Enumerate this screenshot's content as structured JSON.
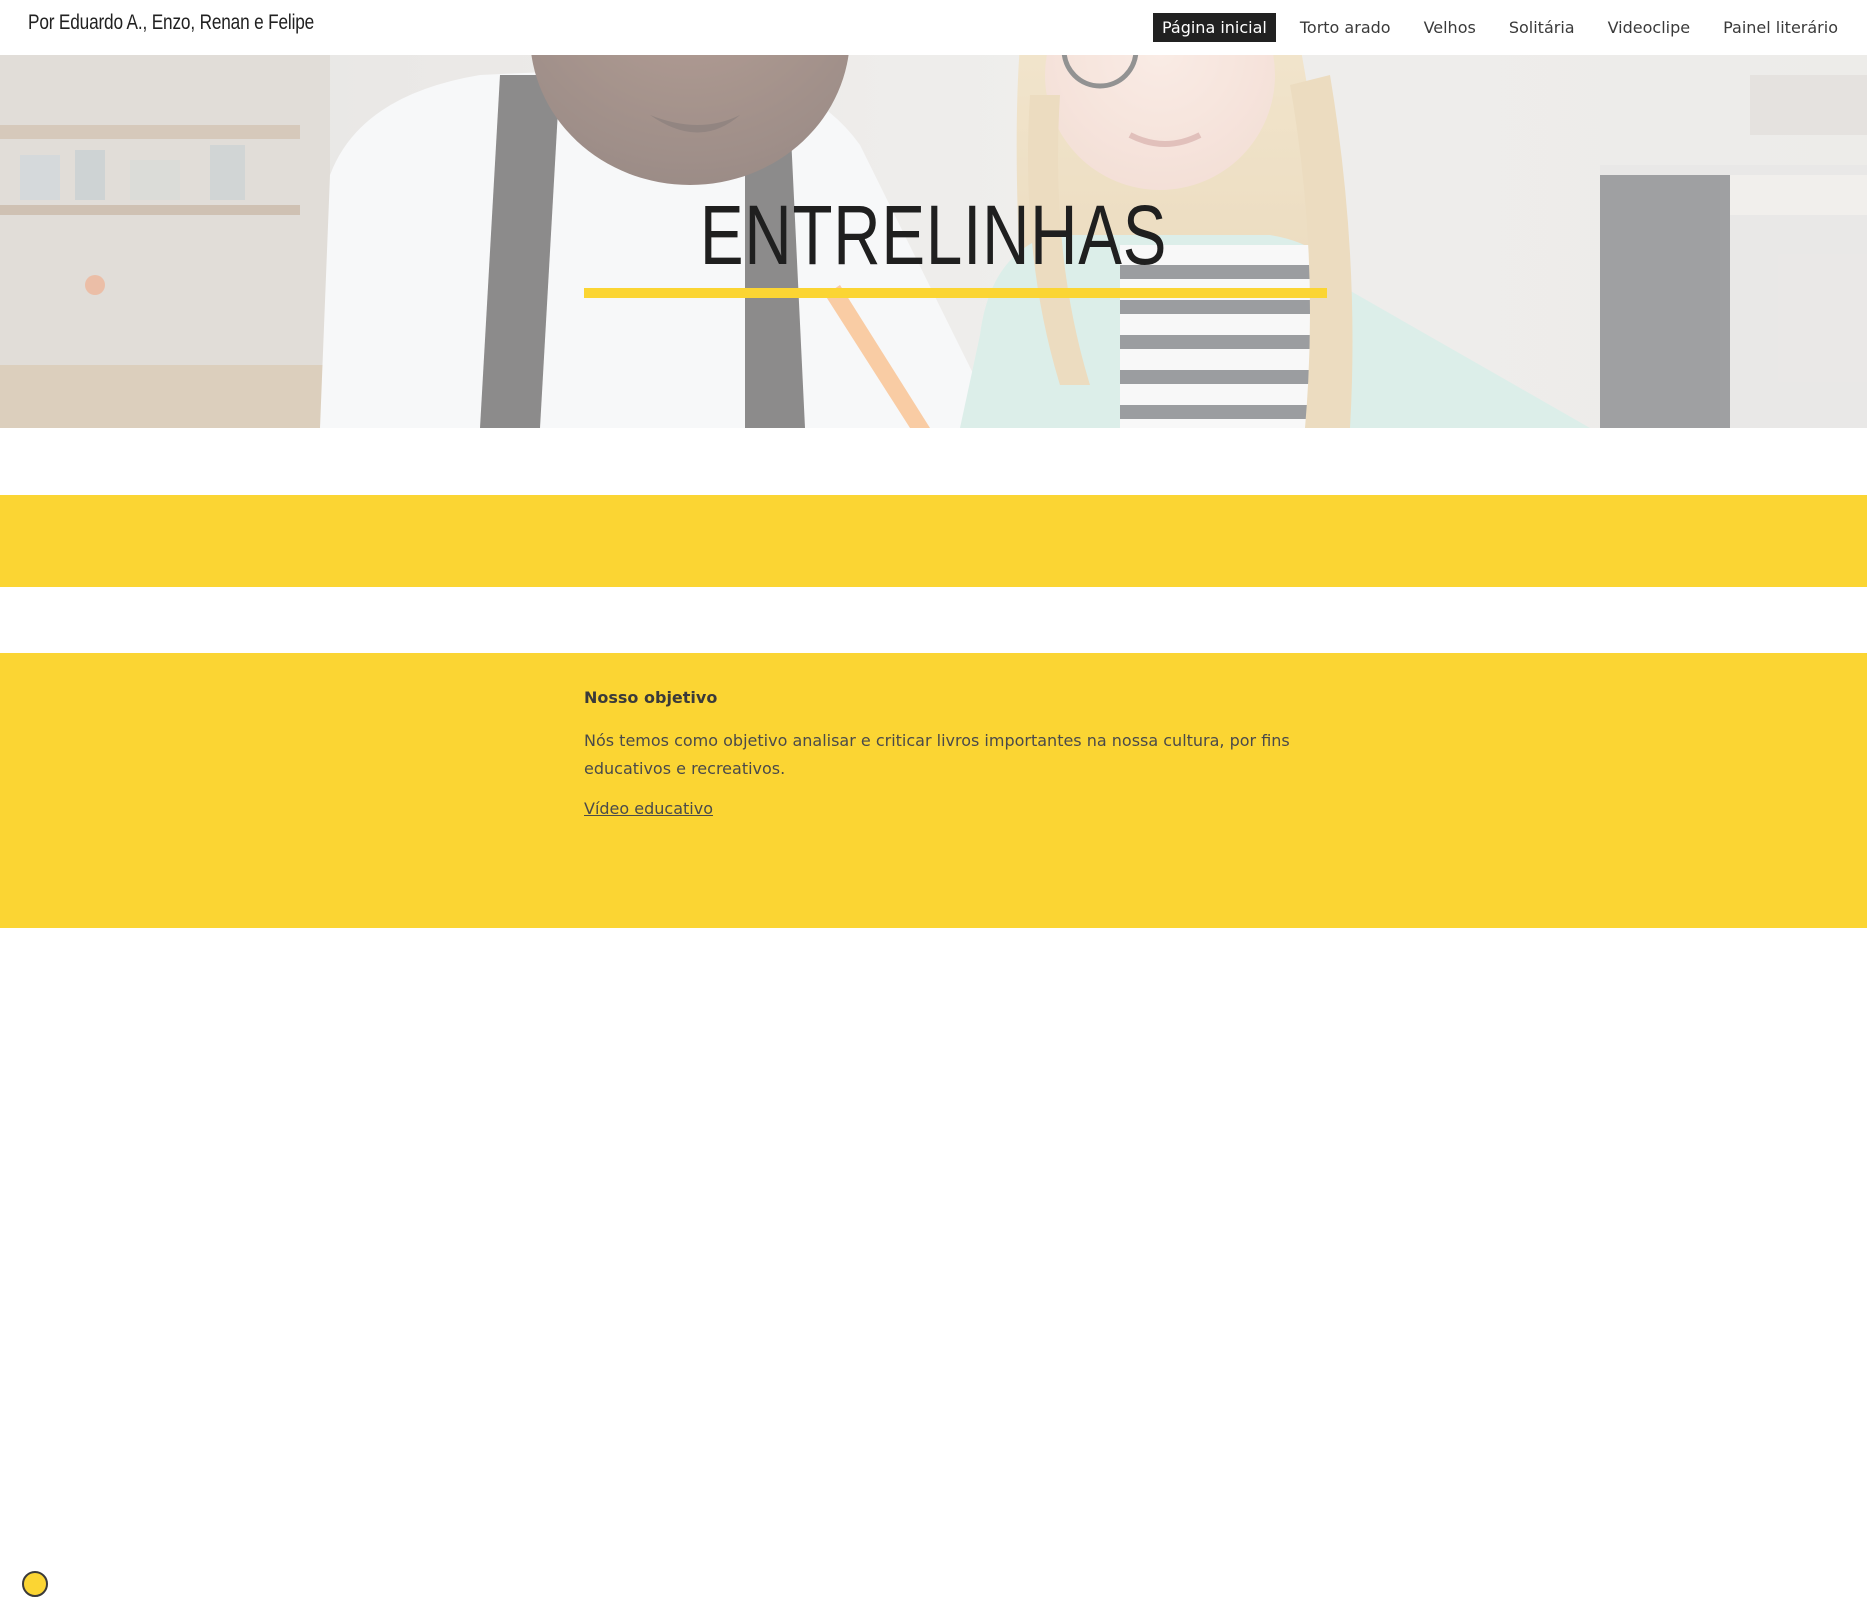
{
  "header": {
    "site_title": "Por Eduardo A., Enzo, Renan e Felipe",
    "nav": [
      {
        "label": "Página inicial",
        "active": true
      },
      {
        "label": "Torto arado",
        "active": false
      },
      {
        "label": "Velhos",
        "active": false
      },
      {
        "label": "Solitária",
        "active": false
      },
      {
        "label": "Videoclipe",
        "active": false
      },
      {
        "label": "Painel literário",
        "active": false
      }
    ]
  },
  "hero": {
    "title": "ENTRELINHAS",
    "accent_color": "#fbd533"
  },
  "objective": {
    "heading": "Nosso objetivo",
    "body": "Nós temos como objetivo analisar e  criticar  livros importantes na nossa cultura, por fins educativos e recreativos.",
    "link_text": "Vídeo educativo"
  },
  "colors": {
    "band_yellow": "#fbd533",
    "active_nav_bg": "#212121",
    "text_dark": "#212121"
  }
}
